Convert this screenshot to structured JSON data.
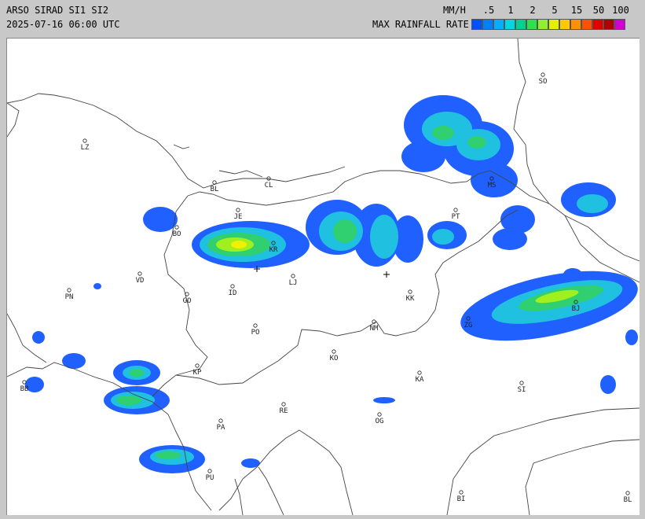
{
  "header": {
    "title": "ARSO SIRAD SI1 SI2",
    "timestamp": "2025-07-16 06:00 UTC",
    "unit": "MM/H",
    "legend_title": "MAX RAINFALL RATE"
  },
  "legend": {
    "ticks": [
      ".5",
      "1",
      "2",
      "5",
      "15",
      "50",
      "100"
    ],
    "colors": [
      "#0050ff",
      "#0080ff",
      "#00b0ff",
      "#00d8e0",
      "#00d090",
      "#30e050",
      "#90f030",
      "#e0f000",
      "#ffc800",
      "#ff9000",
      "#ff5000",
      "#e00000",
      "#b00000",
      "#d000d0"
    ]
  },
  "rain_colors": {
    "light": "#2060ff",
    "moderate": "#20c0e0",
    "medium": "#30d070",
    "heavy": "#a0f020",
    "intense": "#f0f000"
  },
  "cities": [
    {
      "code": "SO"
    },
    {
      "code": "LZ"
    },
    {
      "code": "BL"
    },
    {
      "code": "CL"
    },
    {
      "code": "JE"
    },
    {
      "code": "BO"
    },
    {
      "code": "KR"
    },
    {
      "code": "VD"
    },
    {
      "code": "LJ"
    },
    {
      "code": "PT"
    },
    {
      "code": "MS"
    },
    {
      "code": "PN"
    },
    {
      "code": "GO"
    },
    {
      "code": "ID"
    },
    {
      "code": "KK"
    },
    {
      "code": "BJ"
    },
    {
      "code": "ZG"
    },
    {
      "code": "PO"
    },
    {
      "code": "NM"
    },
    {
      "code": "KO"
    },
    {
      "code": "KP"
    },
    {
      "code": "KA"
    },
    {
      "code": "SI"
    },
    {
      "code": "BB"
    },
    {
      "code": "RE"
    },
    {
      "code": "PA"
    },
    {
      "code": "OG"
    },
    {
      "code": "PU"
    },
    {
      "code": "BI"
    },
    {
      "code": "BL"
    }
  ]
}
